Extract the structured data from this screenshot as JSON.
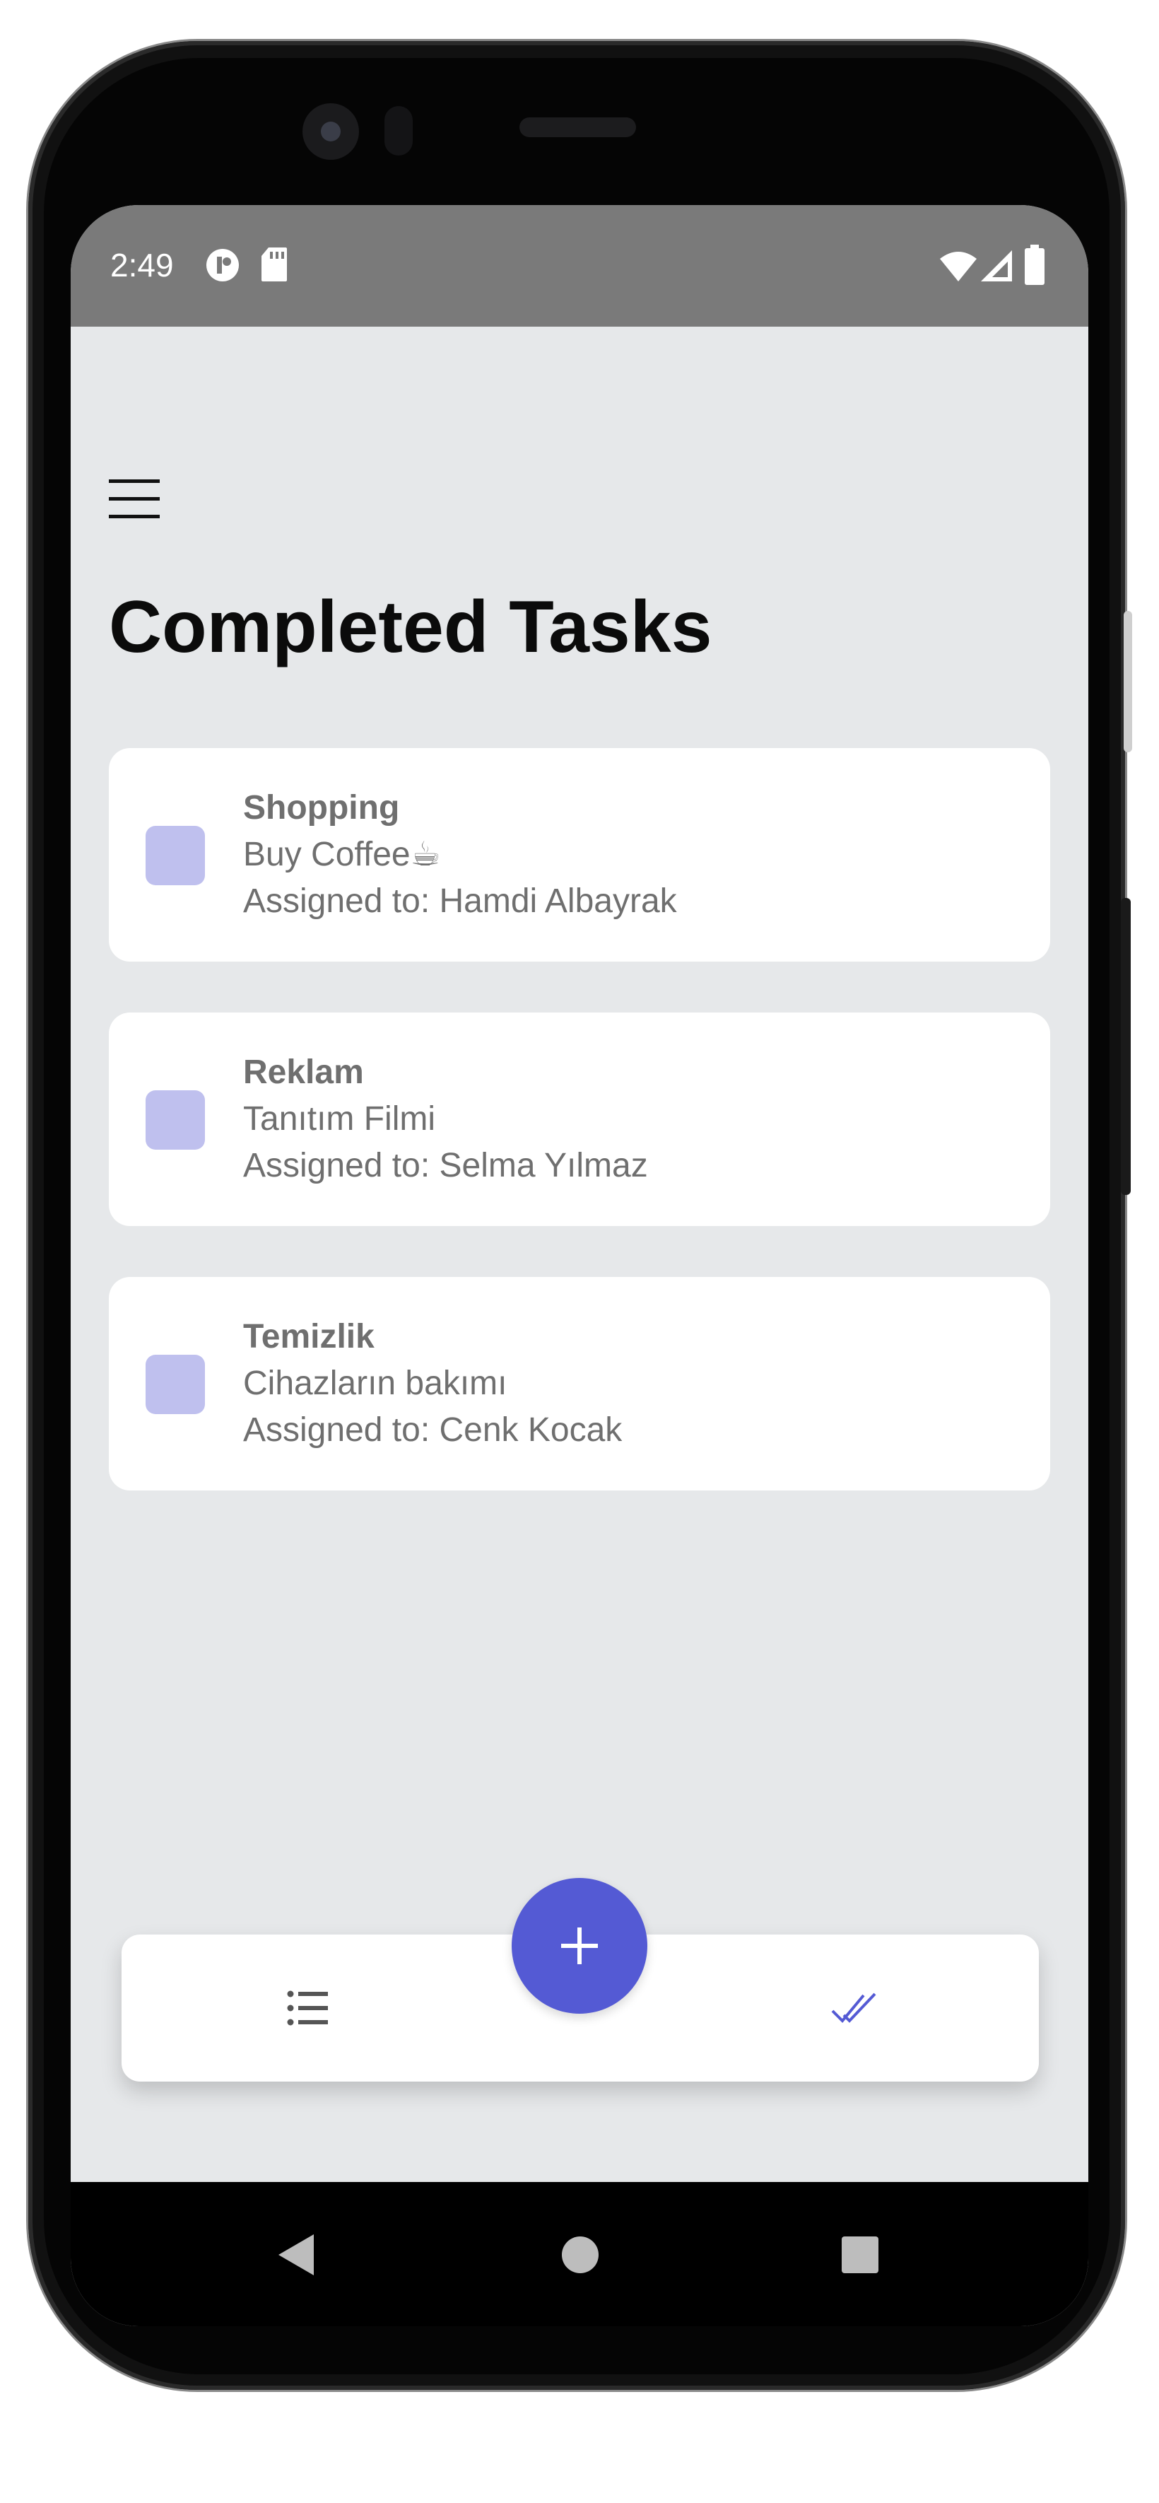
{
  "status_bar": {
    "time": "2:49"
  },
  "header": {
    "title": "Completed Tasks"
  },
  "tasks": [
    {
      "category": "Shopping",
      "title": "Buy Coffee☕",
      "assignee": "Assigned to: Hamdi Albayrak"
    },
    {
      "category": "Reklam",
      "title": "Tanıtım Filmi",
      "assignee": "Assigned to: Selma Yılmaz"
    },
    {
      "category": "Temizlik",
      "title": "Cihazların bakımı",
      "assignee": "Assigned to: Cenk Kocak"
    }
  ],
  "bottom_nav": {
    "left_icon": "list-icon",
    "fab_icon": "plus-icon",
    "right_icon": "double-check-icon"
  },
  "colors": {
    "accent": "#545ad4",
    "checkbox": "#bfc0ee",
    "background": "#e6e8ea",
    "status_bar": "#7a7a7a"
  }
}
